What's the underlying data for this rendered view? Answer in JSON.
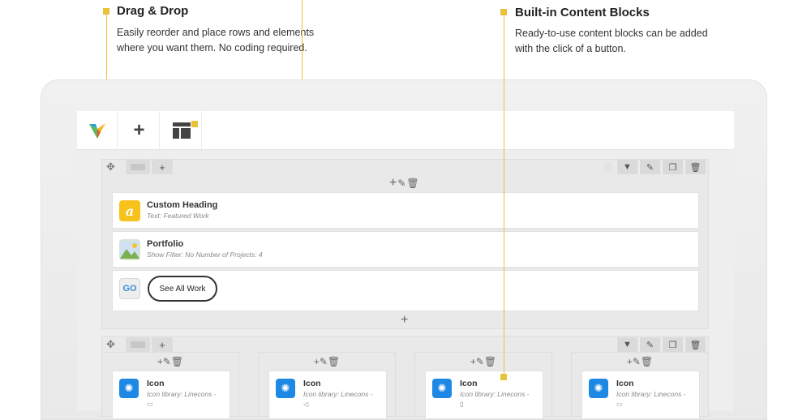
{
  "callouts": {
    "drag": {
      "title": "Drag & Drop",
      "desc_line1": "Easily reorder and place rows and elements",
      "desc_line2": "where you want them. No coding required."
    },
    "blocks": {
      "title": "Built-in Content Blocks",
      "desc_line1": "Ready-to-use content blocks can be added",
      "desc_line2": "with the click of a button."
    },
    "accent_color": "#e8c23b"
  },
  "toolbar": {
    "logo_icon": "vc-logo-icon",
    "add_icon": "plus-icon",
    "add_label": "+",
    "layout_icon": "layout-template-icon"
  },
  "row1": {
    "tools_label": "+",
    "elements": [
      {
        "title": "Custom Heading",
        "subtitle": "Text: Featured Work",
        "icon": "heading-icon",
        "icon_glyph": "a",
        "icon_color": "#f7c21b"
      },
      {
        "title": "Portfolio",
        "subtitle": "Show Filter: No  Number of Projects: 4",
        "icon": "image-icon"
      }
    ],
    "button_element": {
      "badge": "GO",
      "button_label": "See All Work"
    },
    "add_bottom": "+"
  },
  "row2": {
    "columns": [
      {
        "title": "Icon",
        "subtitle": "Icon library: Linecons -",
        "glyph": "▭"
      },
      {
        "title": "Icon",
        "subtitle": "Icon library: Linecons -",
        "glyph": "◁"
      },
      {
        "title": "Icon",
        "subtitle": "Icon library: Linecons -",
        "glyph": "▯"
      },
      {
        "title": "Icon",
        "subtitle": "Icon library: Linecons -",
        "glyph": "▭"
      }
    ]
  }
}
